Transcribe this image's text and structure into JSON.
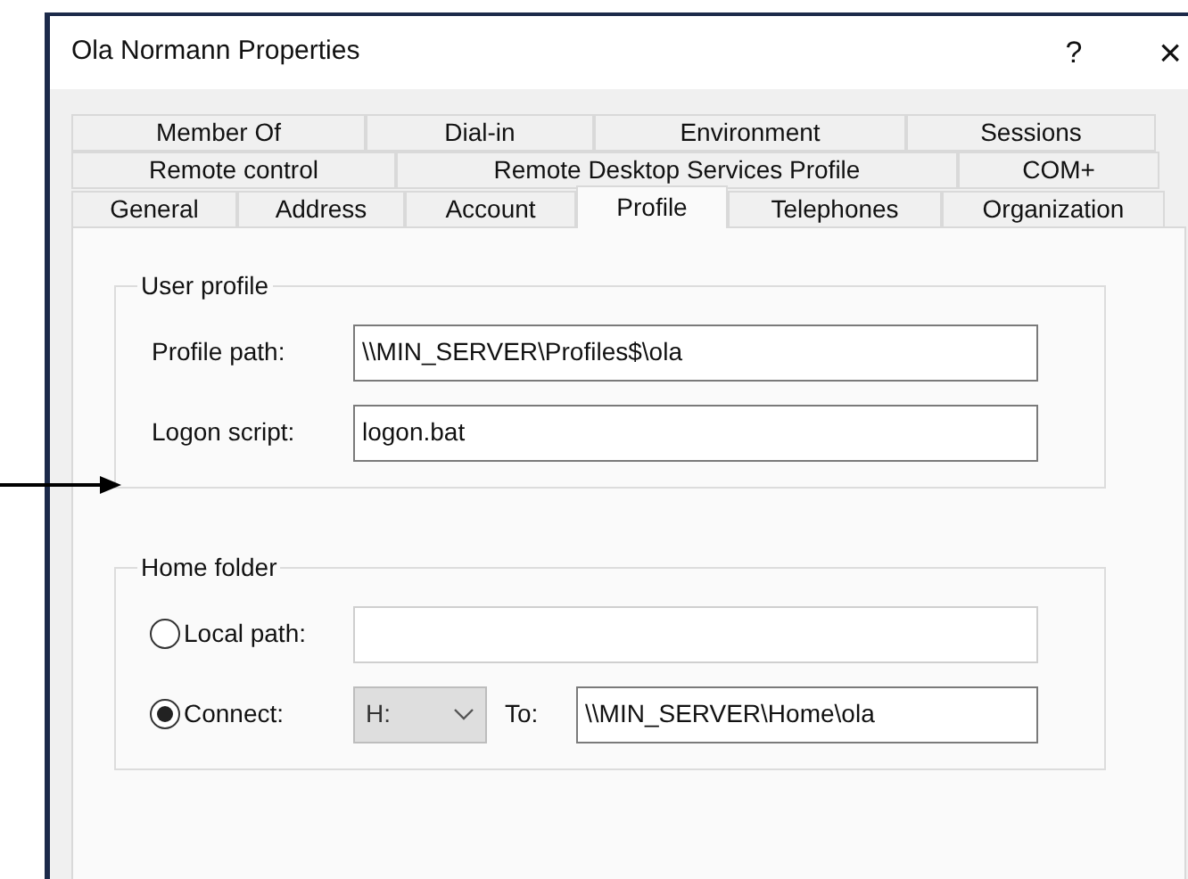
{
  "window": {
    "title": "Ola Normann Properties",
    "help_button": "?",
    "close_button": "×"
  },
  "tab_rows": [
    [
      {
        "label": "Member Of",
        "selected": false
      },
      {
        "label": "Dial-in",
        "selected": false
      },
      {
        "label": "Environment",
        "selected": false
      },
      {
        "label": "Sessions",
        "selected": false
      }
    ],
    [
      {
        "label": "Remote control",
        "selected": false
      },
      {
        "label": "Remote Desktop Services Profile",
        "selected": false
      },
      {
        "label": "COM+",
        "selected": false
      }
    ],
    [
      {
        "label": "General",
        "selected": false
      },
      {
        "label": "Address",
        "selected": false
      },
      {
        "label": "Account",
        "selected": false
      },
      {
        "label": "Profile",
        "selected": true
      },
      {
        "label": "Telephones",
        "selected": false
      },
      {
        "label": "Organization",
        "selected": false
      }
    ]
  ],
  "groups": [
    {
      "title": "User profile",
      "rows": [
        {
          "kind": "text",
          "label": "Profile path:",
          "value": "\\\\MIN_SERVER\\Profiles$\\ola"
        },
        {
          "kind": "text",
          "label": "Logon script:",
          "value": "logon.bat"
        }
      ]
    },
    {
      "title": "Home folder",
      "rows": [
        {
          "kind": "radio",
          "label": "Local path:",
          "selected": false
        },
        {
          "kind": "connect",
          "label": "Connect:",
          "selected": true,
          "drive": "H:",
          "to_label": "To:",
          "value": "\\\\MIN_SERVER\\Home\\ola"
        }
      ]
    }
  ]
}
